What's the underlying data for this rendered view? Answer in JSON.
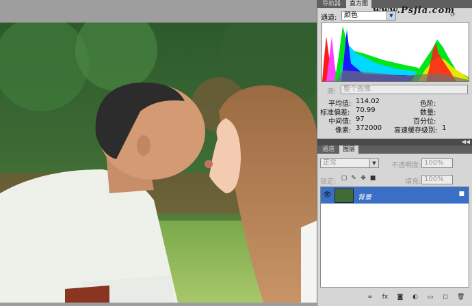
{
  "colors": {
    "panel_bg": "#d6d6d6",
    "tabbar_bg": "#5f5f5f",
    "selection": "#3a6fc6"
  },
  "watermark": "www.Psjia.com",
  "navigator_panel": {
    "tabs": [
      "导航器",
      "直方图"
    ],
    "active_tab": "直方图"
  },
  "histogram": {
    "channel_label": "通道:",
    "channel_value": "颜色",
    "source_label": "源:",
    "source_value": "整个图像",
    "stats": {
      "mean_label": "平均值:",
      "mean": "114.02",
      "std_label": "标准偏差:",
      "std": "70.99",
      "median_label": "中间值:",
      "median": "97",
      "pixels_label": "像素:",
      "pixels": "372000",
      "level_label": "色阶:",
      "level": "",
      "count_label": "数量:",
      "count": "",
      "percentile_label": "百分位:",
      "percentile": "",
      "cache_label": "高速缓存级别:",
      "cache": "1"
    }
  },
  "layers_panel": {
    "tabs": [
      "通道",
      "图层"
    ],
    "active_tab": "图层",
    "blend_mode": "正常",
    "opacity_label": "不透明度:",
    "opacity": "100%",
    "lock_label": "锁定:",
    "fill_label": "填充:",
    "fill": "100%",
    "layers": [
      {
        "name": "背景",
        "visible": true,
        "locked": true
      }
    ]
  },
  "bottom_icons": [
    "link-icon",
    "fx-icon",
    "mask-icon",
    "adjustment-icon",
    "folder-icon",
    "new-layer-icon",
    "trash-icon"
  ]
}
